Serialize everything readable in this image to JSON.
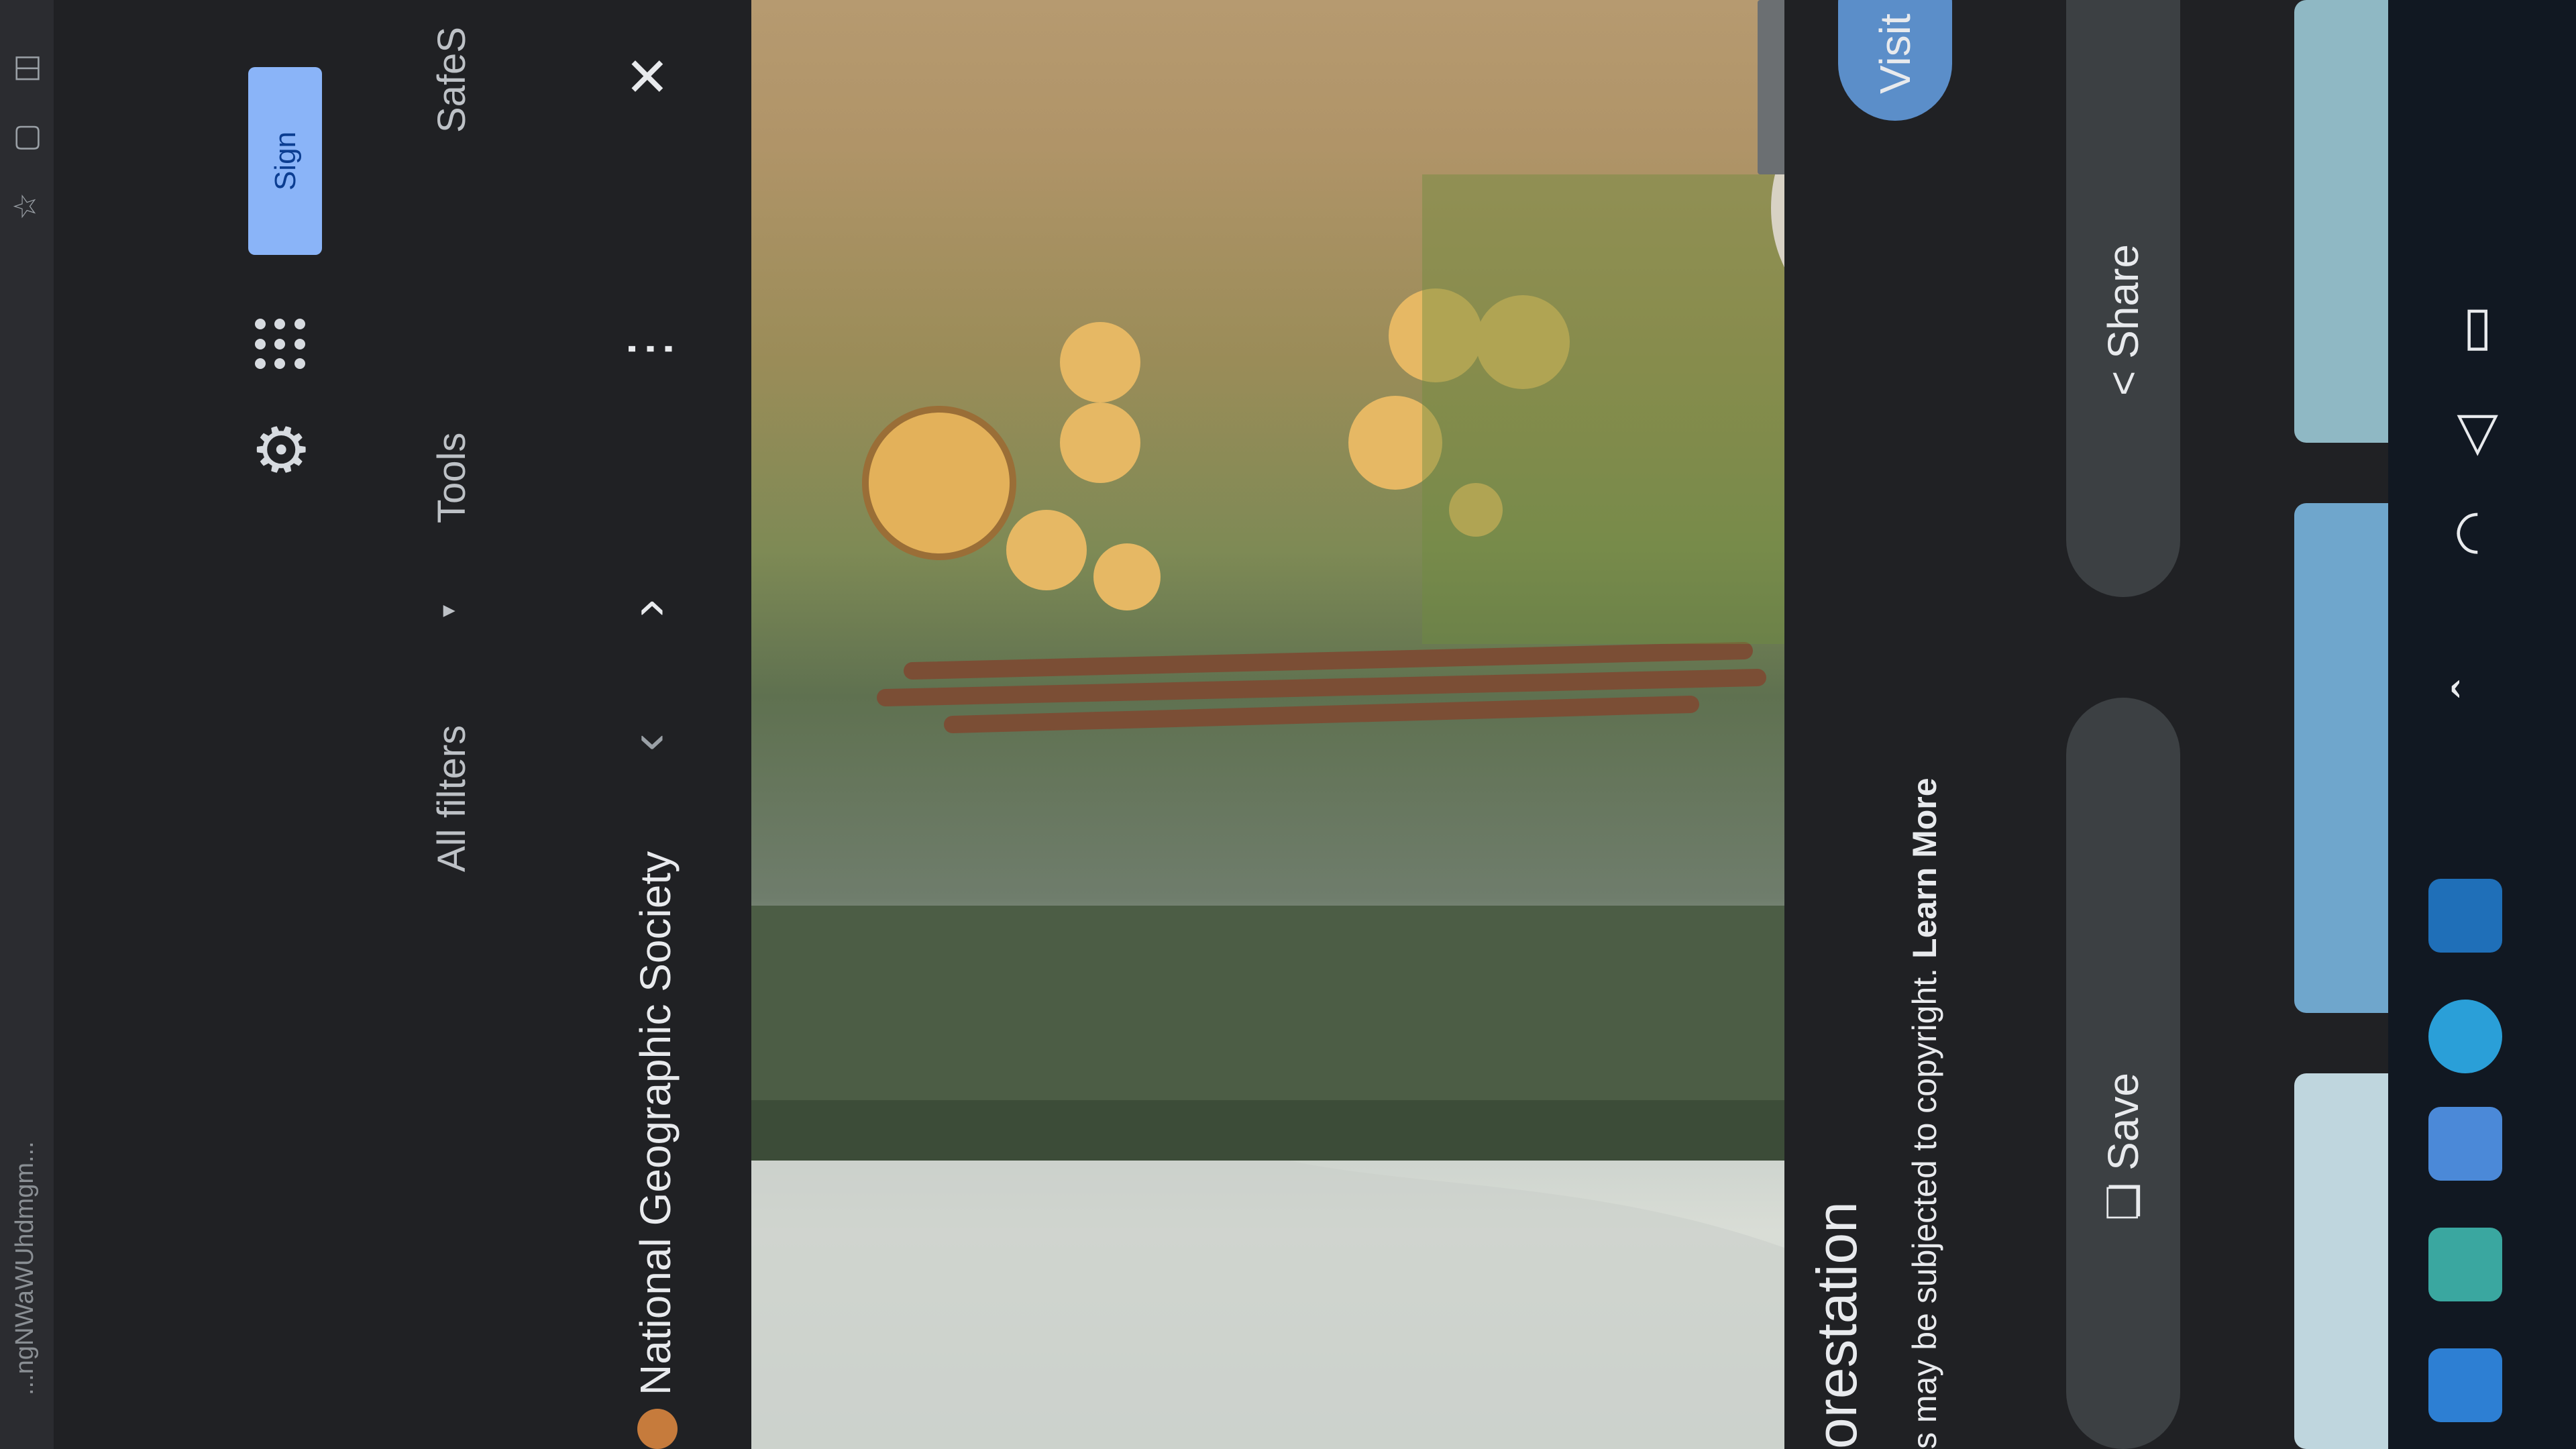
{
  "browser": {
    "url_fragment": "...ngNWaWUhdmgm..."
  },
  "header": {
    "signin_label": "Sign",
    "filters": {
      "all_filters": "All filters",
      "tools": "Tools",
      "safe_search": "SafeS"
    }
  },
  "preview": {
    "source": "National Geographic Society",
    "title": "orestation",
    "copyright": "s may be subjected to copyright.",
    "learn_more": "Learn More",
    "visit_label": "Visit >",
    "save_label": "Save",
    "share_label": "Share"
  },
  "icons": {
    "gear": "gear-icon",
    "apps": "apps-grid-icon",
    "close": "close-icon",
    "more": "more-vert-icon",
    "prev": "chevron-left-icon",
    "next": "chevron-right-icon"
  },
  "colors": {
    "page_bg": "#202124",
    "signin_bg": "#8ab4f8",
    "visit_bg": "#5b8ec9",
    "pill_bg": "#3c4043"
  }
}
